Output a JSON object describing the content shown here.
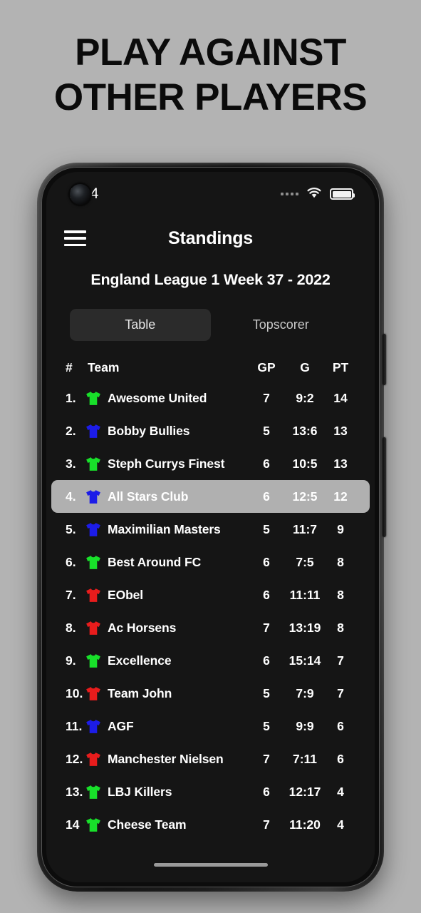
{
  "promo": {
    "line1": "PLAY AGAINST",
    "line2": "OTHER PLAYERS"
  },
  "status_bar": {
    "time": "2.34",
    "signal_icon": "signal-dots-icon",
    "wifi_icon": "wifi-icon",
    "battery_icon": "battery-full-icon"
  },
  "nav": {
    "menu_icon": "hamburger-menu-icon",
    "title": "Standings"
  },
  "league": {
    "title": "England League 1 Week 37 - 2022"
  },
  "tabs": [
    {
      "label": "Table",
      "active": true
    },
    {
      "label": "Topscorer",
      "active": false
    }
  ],
  "table": {
    "headers": {
      "rank": "#",
      "team": "Team",
      "gp": "GP",
      "g": "G",
      "pt": "PT"
    },
    "rows": [
      {
        "rank": "1.",
        "shirt_color": "#18e02a",
        "team": "Awesome United",
        "gp": "7",
        "g": "9:2",
        "pt": "14",
        "highlight": false
      },
      {
        "rank": "2.",
        "shirt_color": "#1c1ce8",
        "team": "Bobby Bullies",
        "gp": "5",
        "g": "13:6",
        "pt": "13",
        "highlight": false
      },
      {
        "rank": "3.",
        "shirt_color": "#18e02a",
        "team": "Steph Currys Finest",
        "gp": "6",
        "g": "10:5",
        "pt": "13",
        "highlight": false
      },
      {
        "rank": "4.",
        "shirt_color": "#1c1ce8",
        "team": "All Stars Club",
        "gp": "6",
        "g": "12:5",
        "pt": "12",
        "highlight": true
      },
      {
        "rank": "5.",
        "shirt_color": "#1c1ce8",
        "team": "Maximilian Masters",
        "gp": "5",
        "g": "11:7",
        "pt": "9",
        "highlight": false
      },
      {
        "rank": "6.",
        "shirt_color": "#18e02a",
        "team": "Best Around FC",
        "gp": "6",
        "g": "7:5",
        "pt": "8",
        "highlight": false
      },
      {
        "rank": "7.",
        "shirt_color": "#e81c1c",
        "team": "EObel",
        "gp": "6",
        "g": "11:11",
        "pt": "8",
        "highlight": false
      },
      {
        "rank": "8.",
        "shirt_color": "#e81c1c",
        "team": "Ac Horsens",
        "gp": "7",
        "g": "13:19",
        "pt": "8",
        "highlight": false
      },
      {
        "rank": "9.",
        "shirt_color": "#18e02a",
        "team": "Excellence",
        "gp": "6",
        "g": "15:14",
        "pt": "7",
        "highlight": false
      },
      {
        "rank": "10.",
        "shirt_color": "#e81c1c",
        "team": "Team John",
        "gp": "5",
        "g": "7:9",
        "pt": "7",
        "highlight": false
      },
      {
        "rank": "11.",
        "shirt_color": "#1c1ce8",
        "team": "AGF",
        "gp": "5",
        "g": "9:9",
        "pt": "6",
        "highlight": false
      },
      {
        "rank": "12.",
        "shirt_color": "#e81c1c",
        "team": "Manchester Nielsen",
        "gp": "7",
        "g": "7:11",
        "pt": "6",
        "highlight": false
      },
      {
        "rank": "13.",
        "shirt_color": "#18e02a",
        "team": "LBJ Killers",
        "gp": "6",
        "g": "12:17",
        "pt": "4",
        "highlight": false
      },
      {
        "rank": "14",
        "shirt_color": "#18e02a",
        "team": "Cheese Team",
        "gp": "7",
        "g": "11:20",
        "pt": "4",
        "highlight": false
      }
    ]
  },
  "colors": {
    "page_background": "#b3b3b3",
    "screen_background": "#151515",
    "tab_active_background": "#2b2b2b",
    "row_highlight_background": "#b0b0b0",
    "text_primary": "#ffffff",
    "shirt_green": "#18e02a",
    "shirt_blue": "#1c1ce8",
    "shirt_red": "#e81c1c"
  },
  "home_indicator": "home-indicator"
}
